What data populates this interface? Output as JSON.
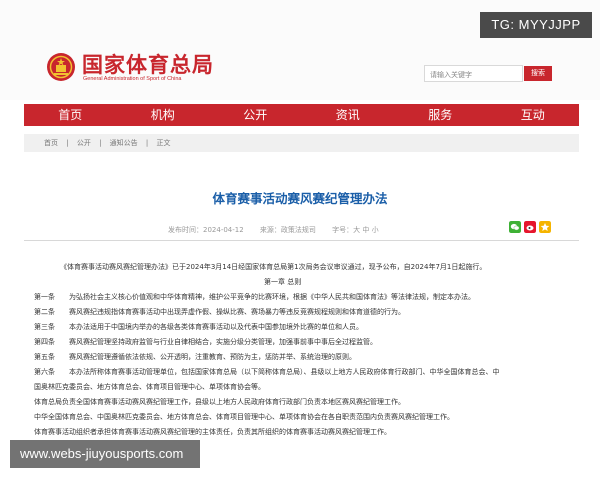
{
  "header": {
    "title_cn": "国家体育总局",
    "title_en": "General Administration of Sport of China",
    "search_placeholder": "请输入关键字",
    "search_button": "搜索"
  },
  "overlay": {
    "tg_badge": "TG: MYYJJPP",
    "watermark": "www.webs-jiuyousports.com"
  },
  "nav": {
    "items": [
      "首页",
      "机构",
      "公开",
      "资讯",
      "服务",
      "互动"
    ]
  },
  "breadcrumb": [
    "首页",
    "公开",
    "通知公告",
    "正文"
  ],
  "article": {
    "title": "体育赛事活动赛风赛纪管理办法",
    "date": "发布时间：2024-04-12",
    "source": "来源：政策法规司",
    "font_size": "字号：大 中 小",
    "intro": "《体育赛事活动赛风赛纪管理办法》已于2024年3月14日经国家体育总局第1次局务会议审议通过，现予公布，自2024年7月1日起施行。",
    "chapter": "第一章    总则",
    "articles": [
      {
        "num": "第一条",
        "text": "为弘扬社会主义核心价值观和中华体育精神，维护公平竞争的比赛环境，根据《中华人民共和国体育法》等法律法规，制定本办法。"
      },
      {
        "num": "第二条",
        "text": "赛风赛纪违规指体育赛事活动中出现弄虚作假、操纵比赛、赛场暴力等违反竞赛规程规则和体育道德的行为。"
      },
      {
        "num": "第三条",
        "text": "本办法适用于中国境内举办的各级各类体育赛事活动以及代表中国参加境外比赛的单位和人员。"
      },
      {
        "num": "第四条",
        "text": "赛风赛纪管理坚持政府监管与行业自律相结合，实施分级分类管理，加强事前事中事后全过程监管。"
      },
      {
        "num": "第五条",
        "text": "赛风赛纪管理遵循依法依规、公开透明，注重教育、预防为主，惩防并举、系统治理的原则。"
      },
      {
        "num": "第六条",
        "text": "本办法所称体育赛事活动管理单位，包括国家体育总局（以下简称体育总局）、县级以上地方人民政府体育行政部门、中华全国体育总会、中"
      }
    ],
    "continuation": [
      "国奥林匹克委员会、地方体育总会、体育项目管理中心、单项体育协会等。",
      "体育总局负责全国体育赛事活动赛风赛纪管理工作，县级以上地方人民政府体育行政部门负责本地区赛风赛纪管理工作。",
      "中华全国体育总会、中国奥林匹克委员会、地方体育总会、体育项目管理中心、单项体育协会在各自职责范围内负责赛风赛纪管理工作。",
      "体育赛事活动组织者承担体育赛事活动赛风赛纪管理的主体责任，负责其所组织的体育赛事活动赛风赛纪管理工作。"
    ]
  },
  "colors": {
    "brand_red": "#c8262d",
    "title_blue": "#1a5ea8",
    "wechat_green": "#3eb135",
    "weibo_red": "#e6162d",
    "qzone_yellow": "#f5b400"
  }
}
